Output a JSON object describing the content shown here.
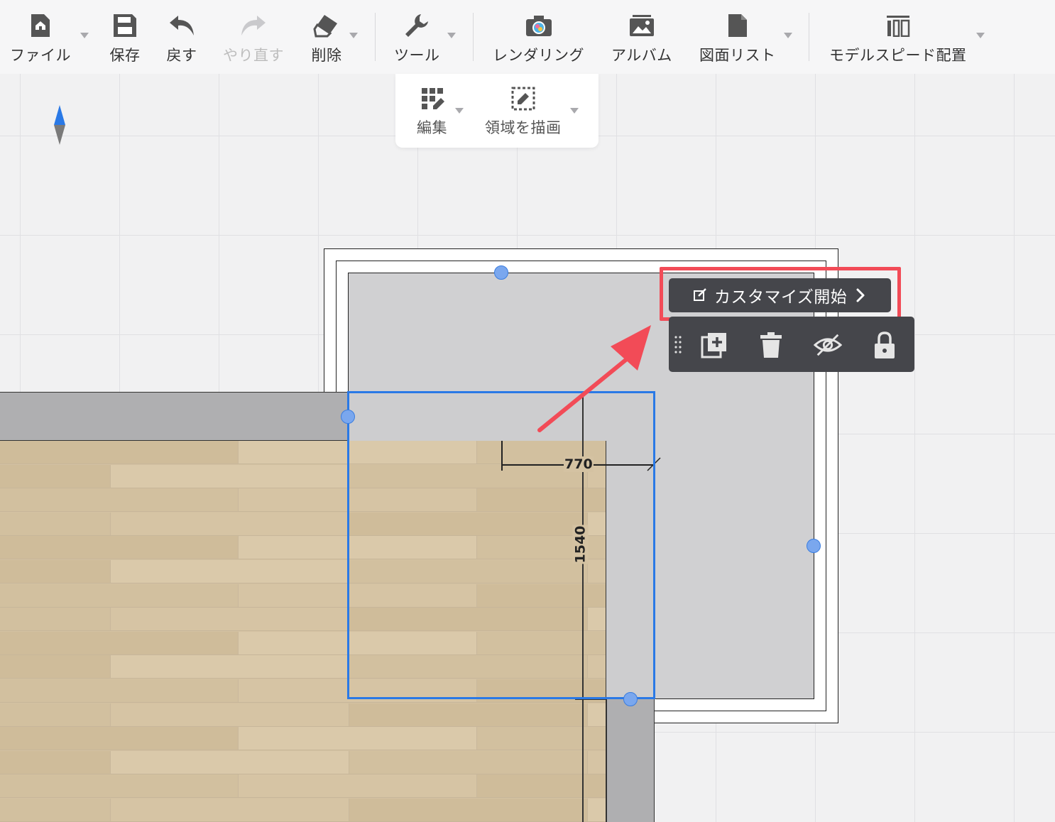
{
  "toolbar": {
    "file": "ファイル",
    "save": "保存",
    "undo": "戻す",
    "redo": "やり直す",
    "delete": "削除",
    "tools": "ツール",
    "rendering": "レンダリング",
    "album": "アルバム",
    "drawing_list": "図面リスト",
    "model_speed": "モデルスピード配置"
  },
  "subbar": {
    "edit": "編集",
    "draw_area": "領域を描画"
  },
  "popup": {
    "customize_label": "カスタマイズ開始"
  },
  "dimensions": {
    "width": "770",
    "height": "1540"
  },
  "colors": {
    "accent_blue": "#2a79e6",
    "highlight_red": "#f24b57",
    "dark_panel": "#45464b"
  },
  "icons": [
    "home-file-icon",
    "save-icon",
    "undo-icon",
    "redo-icon",
    "eraser-icon",
    "wrench-icon",
    "camera-icon",
    "album-icon",
    "document-icon",
    "model-speed-icon",
    "edit-grid-icon",
    "draw-area-icon",
    "edit-icon",
    "chevron-right-icon",
    "drag-handle-icon",
    "duplicate-icon",
    "trash-icon",
    "hide-icon",
    "lock-icon",
    "compass-icon"
  ]
}
